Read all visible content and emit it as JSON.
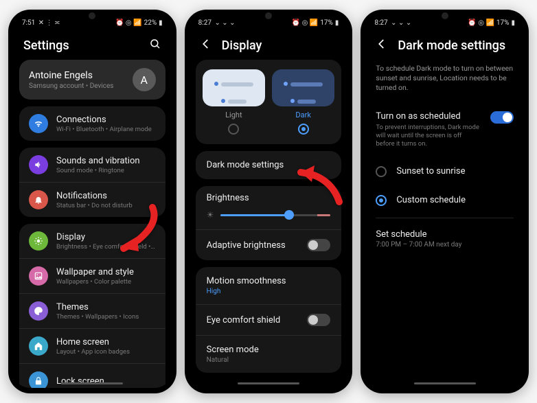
{
  "screen1": {
    "statusbar": {
      "time": "7:51",
      "battery": "22%"
    },
    "header": {
      "title": "Settings"
    },
    "profile": {
      "name": "Antoine Engels",
      "subtitle": "Samsung account  •  Devices",
      "initial": "A"
    },
    "groups": [
      [
        {
          "icon": "wifi",
          "color": "#2f7de0",
          "title": "Connections",
          "subtitle": "Wi-Fi • Bluetooth • Airplane mode"
        }
      ],
      [
        {
          "icon": "sound",
          "color": "#7a3de0",
          "title": "Sounds and vibration",
          "subtitle": "Sound mode • Ringtone"
        },
        {
          "icon": "bell",
          "color": "#d9574a",
          "title": "Notifications",
          "subtitle": "Status bar • Do not disturb"
        }
      ],
      [
        {
          "icon": "display",
          "color": "#6db83a",
          "title": "Display",
          "subtitle": "Brightness • Eye comfort shield • Navigation bar"
        },
        {
          "icon": "wallpaper",
          "color": "#d66aa8",
          "title": "Wallpaper and style",
          "subtitle": "Wallpapers • Color palette"
        },
        {
          "icon": "themes",
          "color": "#8a5fd6",
          "title": "Themes",
          "subtitle": "Themes • Wallpapers • Icons"
        },
        {
          "icon": "home",
          "color": "#3aa8c9",
          "title": "Home screen",
          "subtitle": "Layout • App icon badges"
        },
        {
          "icon": "lock",
          "color": "#3a94d6",
          "title": "Lock screen",
          "subtitle": ""
        }
      ]
    ]
  },
  "screen2": {
    "statusbar": {
      "time": "8:27",
      "battery": "17%"
    },
    "header": {
      "title": "Display"
    },
    "theme": {
      "light_label": "Light",
      "dark_label": "Dark",
      "selected": "dark"
    },
    "dark_mode_settings_label": "Dark mode settings",
    "brightness_label": "Brightness",
    "adaptive_label": "Adaptive brightness",
    "adaptive_on": false,
    "motion_label": "Motion smoothness",
    "motion_value": "High",
    "eyecomfort_label": "Eye comfort shield",
    "eyecomfort_on": false,
    "screenmode_label": "Screen mode",
    "screenmode_value": "Natural"
  },
  "screen3": {
    "statusbar": {
      "time": "8:27",
      "battery": "17%"
    },
    "header": {
      "title": "Dark mode settings"
    },
    "desc": "To schedule Dark mode to turn on between sunset and sunrise, Location needs to be turned on.",
    "turn_on_title": "Turn on as scheduled",
    "turn_on_sub": "To prevent interruptions, Dark mode will wait until the screen is off before it turns on.",
    "turn_on_enabled": true,
    "opt_sunset": "Sunset to sunrise",
    "opt_custom": "Custom schedule",
    "selected_opt": "custom",
    "set_sched_title": "Set schedule",
    "set_sched_sub": "7:00 PM – 7:00 AM next day"
  }
}
